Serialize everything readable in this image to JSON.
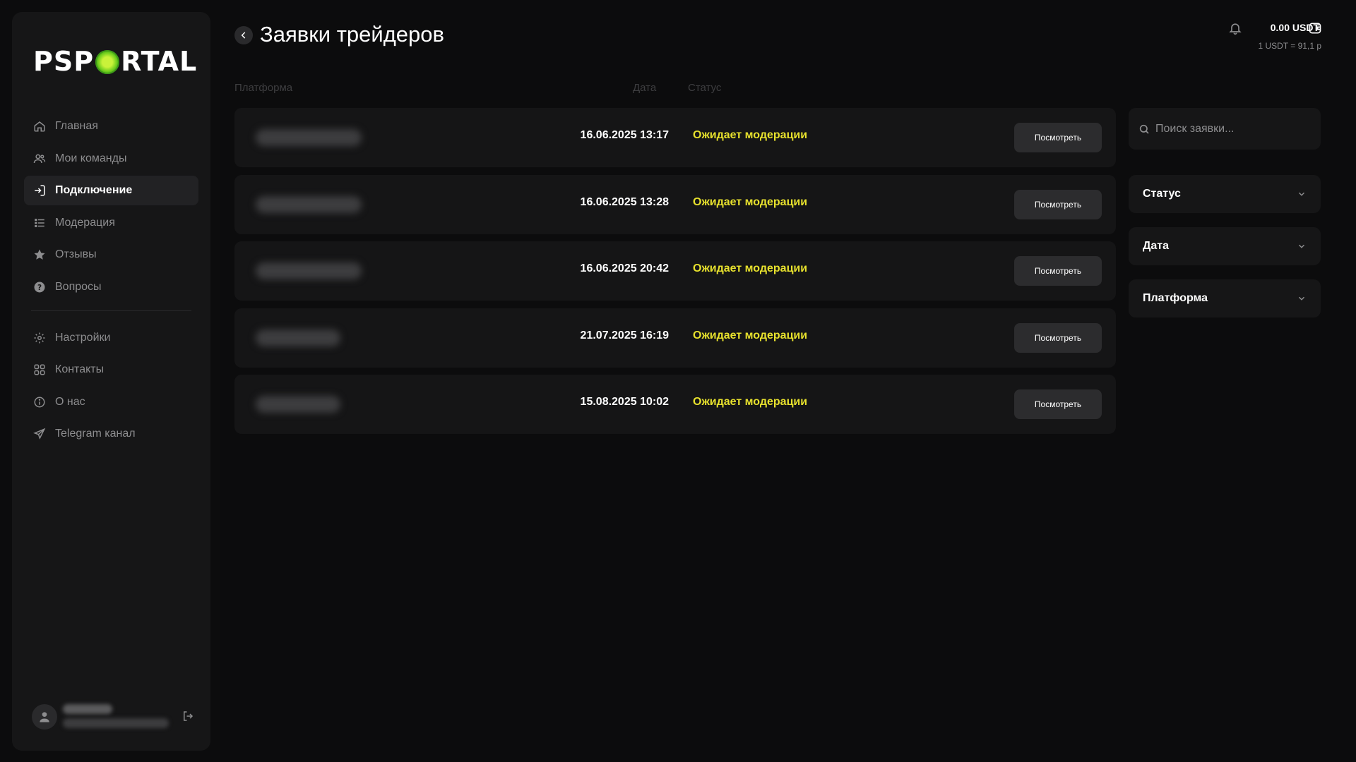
{
  "brand": {
    "logo_left": "PSP",
    "logo_right": "RTAL",
    "logo_letter_o": "O"
  },
  "sidebar": {
    "items": [
      {
        "label": "Главная",
        "icon": "home-icon",
        "active": false
      },
      {
        "label": "Мои команды",
        "icon": "users-icon",
        "active": false
      },
      {
        "label": "Подключение",
        "icon": "login-icon",
        "active": true
      },
      {
        "label": "Модерация",
        "icon": "list-icon",
        "active": false
      },
      {
        "label": "Отзывы",
        "icon": "star-icon",
        "active": false
      },
      {
        "label": "Вопросы",
        "icon": "question-icon",
        "active": false
      }
    ],
    "items_bottom": [
      {
        "label": "Настройки",
        "icon": "gear-icon"
      },
      {
        "label": "Контакты",
        "icon": "grid-icon"
      },
      {
        "label": "О нас",
        "icon": "info-icon"
      },
      {
        "label": "Telegram канал",
        "icon": "send-icon"
      }
    ]
  },
  "header": {
    "title": "Заявки трейдеров",
    "balance": "0.00 USDT",
    "rate": "1 USDT = 91,1 р"
  },
  "table": {
    "columns": [
      "Платформа",
      "Дата",
      "Статус"
    ],
    "view_label": "Посмотреть",
    "rows": [
      {
        "date": "16.06.2025 13:17",
        "status": "Ожидает модерации"
      },
      {
        "date": "16.06.2025 13:28",
        "status": "Ожидает модерации"
      },
      {
        "date": "16.06.2025 20:42",
        "status": "Ожидает модерации"
      },
      {
        "date": "21.07.2025 16:19",
        "status": "Ожидает модерации"
      },
      {
        "date": "15.08.2025 10:02",
        "status": "Ожидает модерации"
      }
    ]
  },
  "filters": {
    "search_placeholder": "Поиск заявки...",
    "status_label": "Статус",
    "date_label": "Дата",
    "platform_label": "Платформа"
  },
  "colors": {
    "background": "#0c0c0d",
    "panel": "#161617",
    "status_pending": "#e7e12d",
    "accent_green": "#6fcf1d"
  }
}
